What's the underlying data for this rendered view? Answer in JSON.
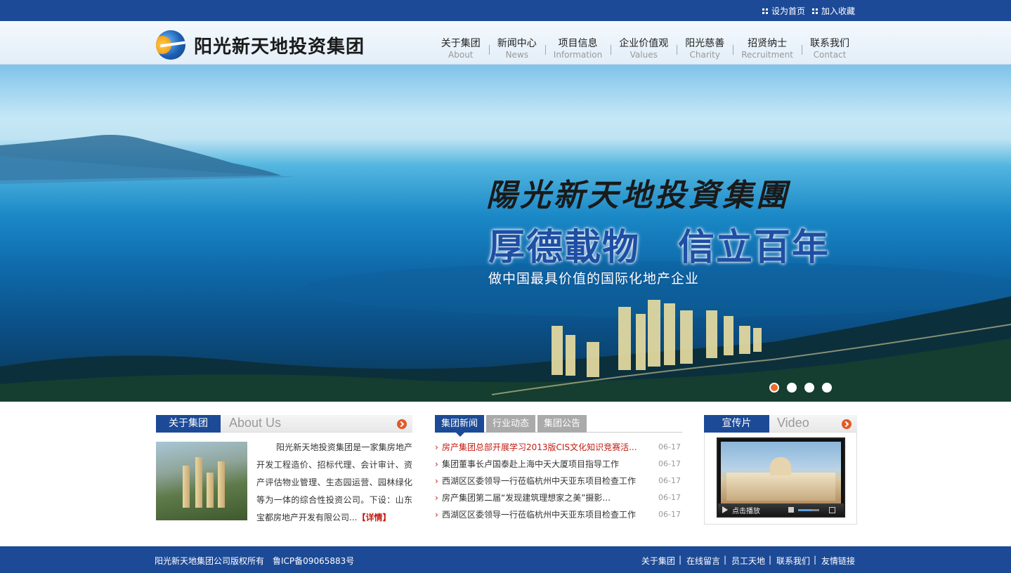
{
  "topbar": {
    "links": [
      {
        "label": "设为首页",
        "icon": "grid-icon"
      },
      {
        "label": "加入收藏",
        "icon": "grid-icon"
      }
    ]
  },
  "header": {
    "logo_text": "阳光新天地投资集团",
    "nav": [
      {
        "cn": "关于集团",
        "en": "About"
      },
      {
        "cn": "新闻中心",
        "en": "News"
      },
      {
        "cn": "项目信息",
        "en": "Information"
      },
      {
        "cn": "企业价值观",
        "en": "Values"
      },
      {
        "cn": "阳光慈善",
        "en": "Charity"
      },
      {
        "cn": "招贤纳士",
        "en": "Recruitment"
      },
      {
        "cn": "联系我们",
        "en": "Contact"
      }
    ]
  },
  "banner": {
    "calligraphy": "陽光新天地投資集團",
    "slogan": "厚德載物　信立百年",
    "subtitle": "做中国最具价值的国际化地产企业",
    "slides": 4,
    "active_slide": 1
  },
  "about": {
    "tag": "关于集团",
    "en": "About Us",
    "text": "阳光新天地投资集团是一家集房地产开发工程造价、招标代理、会计审计、资产评估物业管理、生态园运营、园林绿化等为一体的综合性投资公司。下设：山东宝都房地产开发有限公司...",
    "more_label": "【详情】"
  },
  "news": {
    "tabs": [
      "集团新闻",
      "行业动态",
      "集团公告"
    ],
    "items": [
      {
        "title": "房产集团总部开展学习2013版CIS文化知识竞赛活...",
        "date": "06-17"
      },
      {
        "title": "集团董事长卢国泰赴上海中天大厦项目指导工作",
        "date": "06-17"
      },
      {
        "title": "西湖区区委领导一行莅临杭州中天亚东项目检查工作",
        "date": "06-17"
      },
      {
        "title": "房产集团第二届“发现建筑理想家之美”摄影...",
        "date": "06-17"
      },
      {
        "title": "西湖区区委领导一行莅临杭州中天亚东项目检查工作",
        "date": "06-17"
      }
    ]
  },
  "video": {
    "tag": "宣传片",
    "en": "Video",
    "play_label": "点击播放"
  },
  "footer": {
    "copyright": "阳光新天地集团公司版权所有",
    "icp": "鲁ICP备09065883号",
    "links": [
      "关于集团",
      "在线留言",
      "员工天地",
      "联系我们",
      "友情链接"
    ]
  },
  "colors": {
    "primary": "#1d4a96",
    "accent": "#e05a2b",
    "highlight_red": "#c21a0f"
  }
}
